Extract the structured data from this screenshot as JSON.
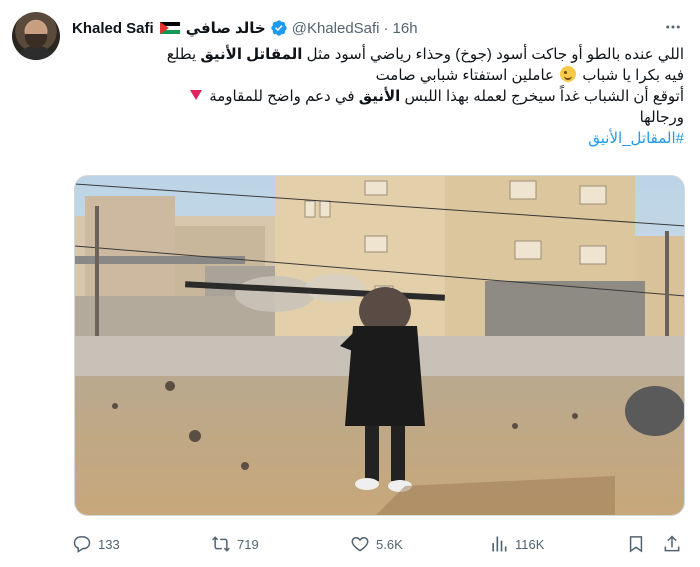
{
  "author": {
    "name": "Khaled Safi",
    "arabic_name": "خالد صافي",
    "handle": "@KhaledSafi",
    "separator": "·",
    "time": "16h"
  },
  "tweet": {
    "line1": "اللي عنده بالطو أو جاكت أسود (جوخ) وحذاء رياضي أسود مثل",
    "line1_bold": "المقاتل الأنيق",
    "line1_end": "يطلع",
    "line2_start": "فيه بكرا يا شباب",
    "line2_end": "عاملين استفتاء شبابي صامت",
    "line3_start": "أتوقع أن الشباب غداً سيخرج لعمله بهذا اللبس",
    "line3_bold": "الأنيق",
    "line3_end": "في دعم واضح للمقاومة",
    "line4": "ورجالها",
    "hashtag": "#المقاتل_الأنيق"
  },
  "actions": {
    "replies": "133",
    "reposts": "719",
    "likes": "5.6K",
    "views": "116K"
  },
  "icons": [
    "more-icon",
    "verified-icon",
    "flag-icon",
    "reply-icon",
    "repost-icon",
    "like-icon",
    "views-icon",
    "bookmark-icon",
    "share-icon"
  ],
  "colors": {
    "text": "#0f1419",
    "secondary": "#536471",
    "accent": "#1d9bf0",
    "flag_red": "#e4312b",
    "flag_green": "#149954"
  }
}
